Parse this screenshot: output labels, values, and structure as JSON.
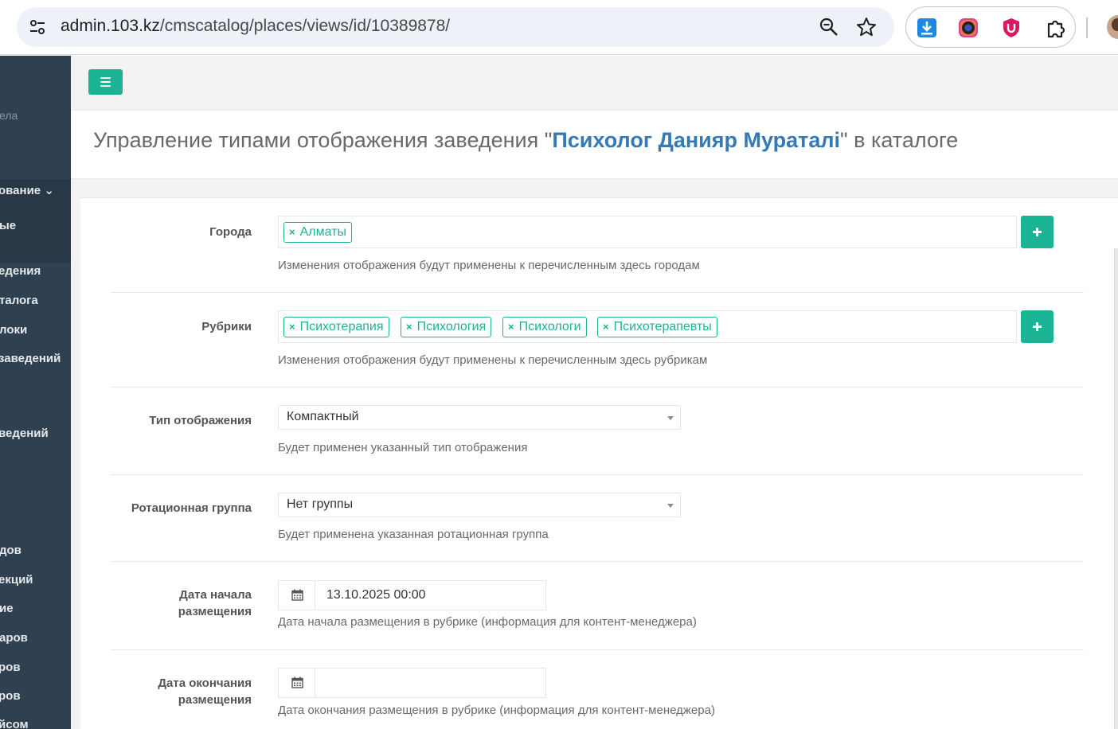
{
  "browser": {
    "url_host": "admin.103.kz",
    "url_path": "/cmscatalog/places/views/id/10389878/"
  },
  "sidebar": {
    "items": [
      {
        "label": "ела",
        "style": "dim"
      },
      {
        "label": "ование ⌄",
        "style": "bold"
      },
      {
        "label": "ые",
        "style": "bold"
      },
      {
        "label": "едения",
        "style": "bold"
      },
      {
        "label": "талога",
        "style": "bold"
      },
      {
        "label": "локи",
        "style": "bold"
      },
      {
        "label": "заведений",
        "style": "bold"
      },
      {
        "label": "ведений",
        "style": "bold"
      },
      {
        "label": "дов",
        "style": "bold"
      },
      {
        "label": "екций",
        "style": "bold"
      },
      {
        "label": "ие",
        "style": "bold"
      },
      {
        "label": "аров",
        "style": "bold"
      },
      {
        "label": "ров",
        "style": "bold"
      },
      {
        "label": "ров",
        "style": "bold"
      },
      {
        "label": "йсом",
        "style": "bold"
      }
    ]
  },
  "page": {
    "title_prefix": "Управление типами отображения заведения \"",
    "place_name": "Психолог Данияр Мураталі",
    "title_suffix": "\" в каталоге"
  },
  "form": {
    "cities": {
      "label": "Города",
      "tags": [
        "Алматы"
      ],
      "help": "Изменения отображения будут применены к перечисленным здесь городам"
    },
    "rubrics": {
      "label": "Рубрики",
      "tags": [
        "Психотерапия",
        "Психология",
        "Психологи",
        "Психотерапевты"
      ],
      "help": "Изменения отображения будут применены к перечисленным здесь рубрикам"
    },
    "display_type": {
      "label": "Тип отображения",
      "value": "Компактный",
      "help": "Будет применен указанный тип отображения"
    },
    "rotation_group": {
      "label": "Ротационная группа",
      "value": "Нет группы",
      "help": "Будет применена указанная ротационная группа"
    },
    "start_date": {
      "label_line1": "Дата начала",
      "label_line2": "размещения",
      "value": "13.10.2025 00:00",
      "help": "Дата начала размещения в рубрике (информация для контент-менеджера)"
    },
    "end_date": {
      "label_line1": "Дата окончания",
      "label_line2": "размещения",
      "value": "",
      "help": "Дата окончания размещения в рубрике (информация для контент-менеджера)"
    }
  },
  "colors": {
    "primary": "#1ab394",
    "sidebar": "#2f4050",
    "link": "#337ab7"
  }
}
